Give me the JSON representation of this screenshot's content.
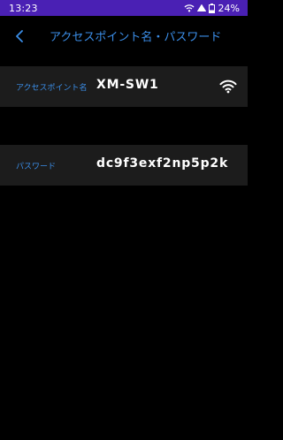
{
  "status_bar": {
    "time": "13:23",
    "battery": "24%",
    "icons": [
      "wifi-calling-icon",
      "wifi-signal-icon",
      "battery-icon"
    ]
  },
  "app_bar": {
    "title": "アクセスポイント名・パスワード",
    "back_icon": "chevron-left-icon"
  },
  "access_point": {
    "label": "アクセスポイント名",
    "value": "XM-SW1",
    "icon": "wifi-icon"
  },
  "password": {
    "label": "パスワード",
    "value": "dc9f3exf2np5p2k"
  },
  "colors": {
    "status_bar": "#4a20b4",
    "accent": "#3b8ee8",
    "background": "#000000",
    "row_background": "#1c1c1c"
  }
}
